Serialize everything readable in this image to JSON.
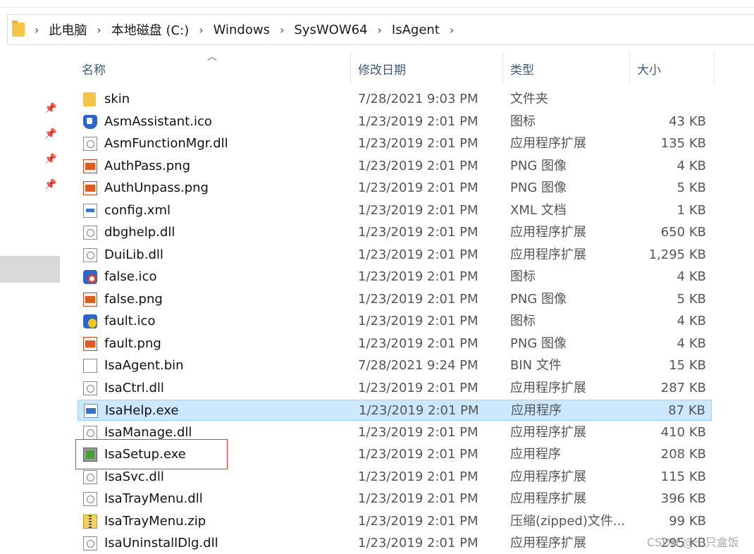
{
  "breadcrumb": {
    "folder_icon": "folder-icon",
    "parts": [
      "此电脑",
      "本地磁盘 (C:)",
      "Windows",
      "SysWOW64",
      "IsAgent"
    ]
  },
  "columns": {
    "name": "名称",
    "date": "修改日期",
    "type": "类型",
    "size": "大小"
  },
  "files": [
    {
      "name": "skin",
      "date": "7/28/2021 9:03 PM",
      "type": "文件夹",
      "size": "",
      "icon": "folder-icon"
    },
    {
      "name": "AsmAssistant.ico",
      "date": "1/23/2019 2:01 PM",
      "type": "图标",
      "size": "43 KB",
      "icon": "shield-icon"
    },
    {
      "name": "AsmFunctionMgr.dll",
      "date": "1/23/2019 2:01 PM",
      "type": "应用程序扩展",
      "size": "135 KB",
      "icon": "dll-icon"
    },
    {
      "name": "AuthPass.png",
      "date": "1/23/2019 2:01 PM",
      "type": "PNG 图像",
      "size": "4 KB",
      "icon": "image-icon"
    },
    {
      "name": "AuthUnpass.png",
      "date": "1/23/2019 2:01 PM",
      "type": "PNG 图像",
      "size": "5 KB",
      "icon": "image-icon"
    },
    {
      "name": "config.xml",
      "date": "1/23/2019 2:01 PM",
      "type": "XML 文档",
      "size": "1 KB",
      "icon": "xml-icon"
    },
    {
      "name": "dbghelp.dll",
      "date": "1/23/2019 2:01 PM",
      "type": "应用程序扩展",
      "size": "650 KB",
      "icon": "dll-icon"
    },
    {
      "name": "DuiLib.dll",
      "date": "1/23/2019 2:01 PM",
      "type": "应用程序扩展",
      "size": "1,295 KB",
      "icon": "dll-icon"
    },
    {
      "name": "false.ico",
      "date": "1/23/2019 2:01 PM",
      "type": "图标",
      "size": "4 KB",
      "icon": "false-icon"
    },
    {
      "name": "false.png",
      "date": "1/23/2019 2:01 PM",
      "type": "PNG 图像",
      "size": "5 KB",
      "icon": "image-icon"
    },
    {
      "name": "fault.ico",
      "date": "1/23/2019 2:01 PM",
      "type": "图标",
      "size": "4 KB",
      "icon": "fault-icon"
    },
    {
      "name": "fault.png",
      "date": "1/23/2019 2:01 PM",
      "type": "PNG 图像",
      "size": "4 KB",
      "icon": "image-icon"
    },
    {
      "name": "IsaAgent.bin",
      "date": "7/28/2021 9:24 PM",
      "type": "BIN 文件",
      "size": "15 KB",
      "icon": "blank-file-icon"
    },
    {
      "name": "IsaCtrl.dll",
      "date": "1/23/2019 2:01 PM",
      "type": "应用程序扩展",
      "size": "287 KB",
      "icon": "dll-icon"
    },
    {
      "name": "IsaHelp.exe",
      "date": "1/23/2019 2:01 PM",
      "type": "应用程序",
      "size": "87 KB",
      "icon": "exe-icon",
      "selected": true
    },
    {
      "name": "IsaManage.dll",
      "date": "1/23/2019 2:01 PM",
      "type": "应用程序扩展",
      "size": "410 KB",
      "icon": "dll-icon"
    },
    {
      "name": "IsaSetup.exe",
      "date": "1/23/2019 2:01 PM",
      "type": "应用程序",
      "size": "208 KB",
      "icon": "setup-icon",
      "highlighted": true
    },
    {
      "name": "IsaSvc.dll",
      "date": "1/23/2019 2:01 PM",
      "type": "应用程序扩展",
      "size": "115 KB",
      "icon": "dll-icon"
    },
    {
      "name": "IsaTrayMenu.dll",
      "date": "1/23/2019 2:01 PM",
      "type": "应用程序扩展",
      "size": "396 KB",
      "icon": "dll-icon"
    },
    {
      "name": "IsaTrayMenu.zip",
      "date": "1/23/2019 2:01 PM",
      "type": "压缩(zipped)文件...",
      "size": "99 KB",
      "icon": "zip-icon"
    },
    {
      "name": "IsaUninstallDlg.dll",
      "date": "1/23/2019 2:01 PM",
      "type": "应用程序扩展",
      "size": "295 KB",
      "icon": "dll-icon"
    }
  ],
  "watermark": "CSDN @一只盒饭",
  "colors": {
    "selection": "#cce8ff",
    "selection_border": "#99d1ff",
    "highlight_box": "#e23b3b",
    "header_text": "#3b5a7a"
  }
}
